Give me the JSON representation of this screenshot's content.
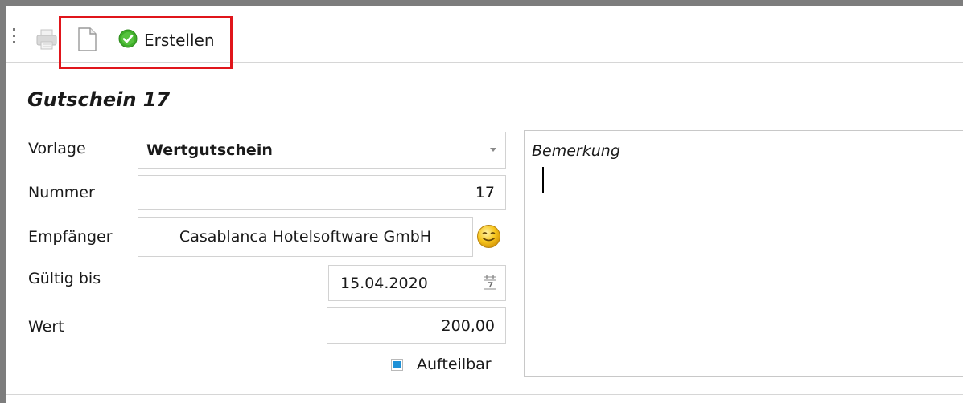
{
  "toolbar": {
    "print_icon": "printer-icon",
    "new_icon": "document-icon",
    "create_icon": "check-circle-icon",
    "create_label": "Erstellen"
  },
  "form": {
    "title": "Gutschein 17",
    "vorlage_label": "Vorlage",
    "vorlage_value": "Wertgutschein",
    "nummer_label": "Nummer",
    "nummer_value": "17",
    "empfaenger_label": "Empfänger",
    "empfaenger_value": "Casablanca Hotelsoftware GmbH",
    "gueltig_label": "Gültig bis",
    "gueltig_value": "15.04.2020",
    "wert_label": "Wert",
    "wert_value": "200,00",
    "aufteilbar_label": "Aufteilbar",
    "aufteilbar_checked": true,
    "bemerkung_placeholder": "Bemerkung"
  },
  "colors": {
    "highlight": "#e0151b",
    "accent": "#1e90d6",
    "success": "#3fae2a"
  }
}
